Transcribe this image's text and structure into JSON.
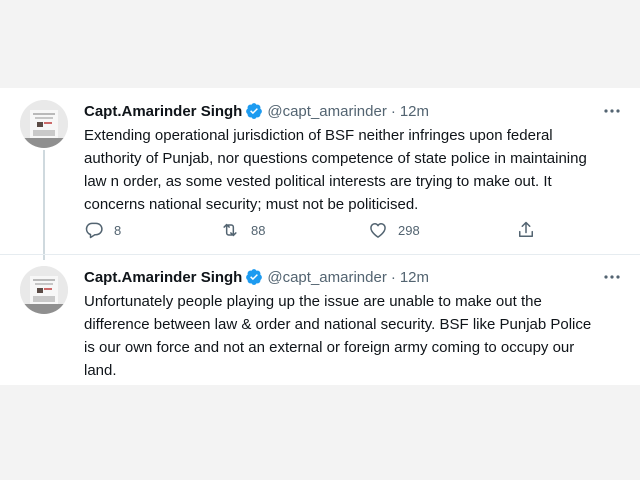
{
  "tweets": [
    {
      "author": {
        "name": "Capt.Amarinder Singh",
        "handle": "@capt_amarinder",
        "verified": true
      },
      "separator": "·",
      "time": "12m",
      "text": "Extending operational jurisdiction of BSF neither infringes upon federal authority of Punjab, nor questions competence of state police in maintaining law n order, as some vested political interests are trying to make out. It concerns national security; must not be politicised.",
      "actions": {
        "replies": "8",
        "retweets": "88",
        "likes": "298"
      }
    },
    {
      "author": {
        "name": "Capt.Amarinder Singh",
        "handle": "@capt_amarinder",
        "verified": true
      },
      "separator": "·",
      "time": "12m",
      "text": "Unfortunately people playing up the issue are unable to make out the difference between law & order and national security. BSF like Punjab Police is our own force and not an external or foreign army coming to occupy our land."
    }
  ],
  "colors": {
    "text_primary": "#0f1419",
    "text_secondary": "#536471",
    "verified_blue": "#1d9bf0",
    "thread_line": "#cfd9de",
    "page_background": "#f3f3f3"
  },
  "icons": [
    "verified-badge-icon",
    "more-options-icon",
    "reply-icon",
    "retweet-icon",
    "like-icon",
    "share-icon"
  ]
}
